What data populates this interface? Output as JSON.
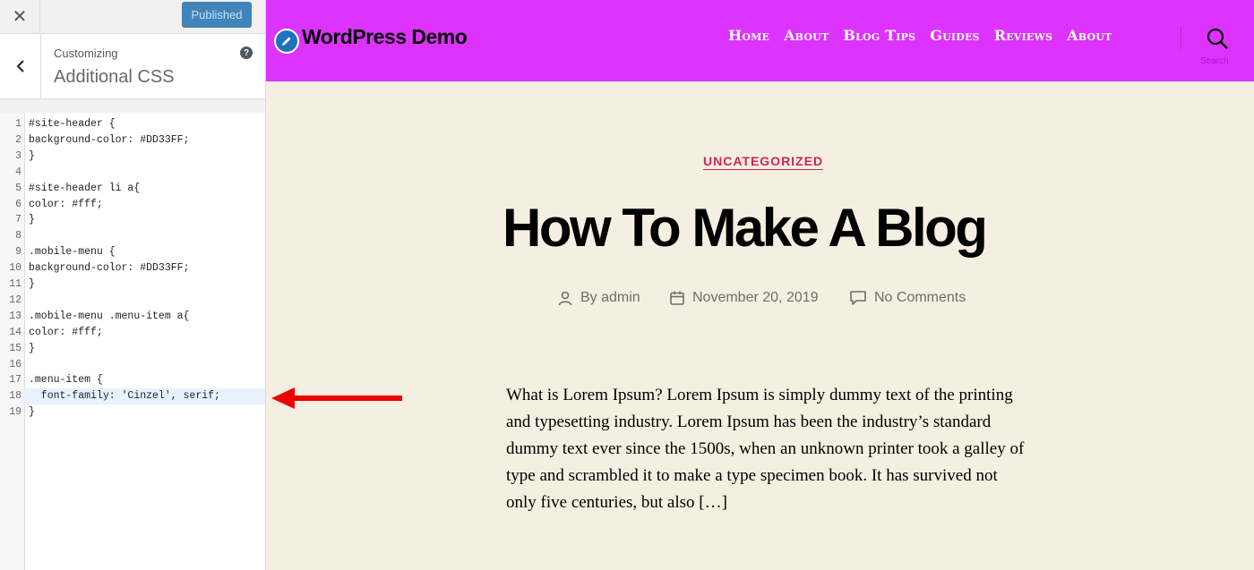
{
  "customizer": {
    "close_glyph": "✕",
    "publish_label": "Published",
    "customizing_label": "Customizing",
    "section_title": "Additional CSS",
    "help_glyph": "?",
    "code_lines": [
      "#site-header {",
      "background-color: #DD33FF;",
      "}",
      "",
      "#site-header li a{",
      "color: #fff;",
      "}",
      "",
      ".mobile-menu {",
      "background-color: #DD33FF;",
      "}",
      "",
      ".mobile-menu .menu-item a{",
      "color: #fff;",
      "}",
      "",
      ".menu-item {",
      "  font-family: 'Cinzel', serif;",
      "}"
    ],
    "active_line": 18
  },
  "site": {
    "header_color": "#DD33FF",
    "title": "WordPress Demo",
    "nav": [
      "Home",
      "About",
      "Blog Tips",
      "Guides",
      "Reviews",
      "About"
    ],
    "search_label": "Search"
  },
  "post": {
    "category": "UNCATEGORIZED",
    "title": "How To Make A Blog",
    "author": "By admin",
    "date": "November 20, 2019",
    "comments": "No Comments",
    "excerpt": "What is Lorem Ipsum? Lorem Ipsum is simply dummy text of the printing and typesetting industry. Lorem Ipsum has been the industry’s standard dummy text ever since the 1500s, when an unknown printer took a galley of type and scrambled it to make a type specimen book. It has survived not only five centuries, but also […]"
  },
  "colors": {
    "accent": "#cd2653",
    "publish_button": "#2271b1",
    "annotation_arrow": "#ee0000"
  }
}
